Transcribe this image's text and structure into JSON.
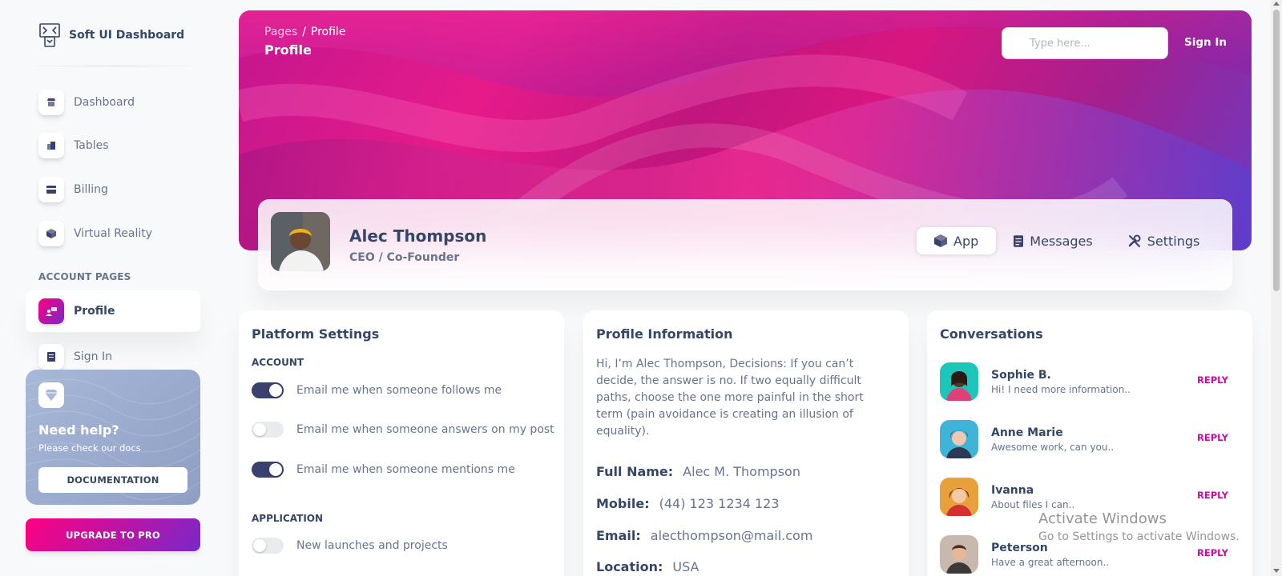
{
  "brand": {
    "title": "Soft UI Dashboard",
    "icon": "dashboard-logo-icon"
  },
  "sidebar": {
    "items": [
      {
        "label": "Dashboard",
        "icon": "shop-icon"
      },
      {
        "label": "Tables",
        "icon": "office-icon"
      },
      {
        "label": "Billing",
        "icon": "credit-card-icon"
      },
      {
        "label": "Virtual Reality",
        "icon": "box-3d-icon"
      }
    ],
    "section_title": "ACCOUNT PAGES",
    "account_items": [
      {
        "label": "Profile",
        "icon": "customer-support-icon",
        "active": true
      },
      {
        "label": "Sign In",
        "icon": "document-icon"
      }
    ],
    "help": {
      "title": "Need help?",
      "subtitle": "Please check our docs",
      "button": "DOCUMENTATION",
      "icon": "diamond-icon"
    },
    "upgrade_button": "UPGRADE TO PRO"
  },
  "header": {
    "breadcrumb": {
      "root": "Pages",
      "separator": "/",
      "current": "Profile"
    },
    "title": "Profile",
    "search_placeholder": "Type here...",
    "sign_in": "Sign In"
  },
  "profile": {
    "name": "Alec Thompson",
    "role": "CEO / Co-Founder",
    "tabs": [
      {
        "label": "App",
        "icon": "cube-icon",
        "active": true
      },
      {
        "label": "Messages",
        "icon": "document-icon"
      },
      {
        "label": "Settings",
        "icon": "settings-icon"
      }
    ]
  },
  "platform_settings": {
    "title": "Platform Settings",
    "account_header": "ACCOUNT",
    "account_toggles": [
      {
        "label": "Email me when someone follows me",
        "on": true
      },
      {
        "label": "Email me when someone answers on my post",
        "on": false
      },
      {
        "label": "Email me when someone mentions me",
        "on": true
      }
    ],
    "application_header": "APPLICATION",
    "application_toggles": [
      {
        "label": "New launches and projects",
        "on": false
      }
    ]
  },
  "profile_information": {
    "title": "Profile Information",
    "bio": "Hi, I’m Alec Thompson, Decisions: If you can’t decide, the answer is no. If two equally difficult paths, choose the one more painful in the short term (pain avoidance is creating an illusion of equality).",
    "fields": [
      {
        "key": "Full Name:",
        "value": "Alec M. Thompson"
      },
      {
        "key": "Mobile:",
        "value": "(44) 123 1234 123"
      },
      {
        "key": "Email:",
        "value": "alecthompson@mail.com"
      },
      {
        "key": "Location:",
        "value": "USA"
      }
    ]
  },
  "conversations": {
    "title": "Conversations",
    "items": [
      {
        "name": "Sophie B.",
        "message": "Hi! I need more information..",
        "action": "REPLY"
      },
      {
        "name": "Anne Marie",
        "message": "Awesome work, can you..",
        "action": "REPLY"
      },
      {
        "name": "Ivanna",
        "message": "About files I can..",
        "action": "REPLY"
      },
      {
        "name": "Peterson",
        "message": "Have a great afternoon..",
        "action": "REPLY"
      }
    ]
  },
  "watermark": {
    "line1": "Activate Windows",
    "line2": "Go to Settings to activate Windows."
  },
  "colors": {
    "accent": "#cb0c9f",
    "toggle_on": "#3a416f",
    "text_primary": "#344767",
    "text_secondary": "#67748e"
  }
}
